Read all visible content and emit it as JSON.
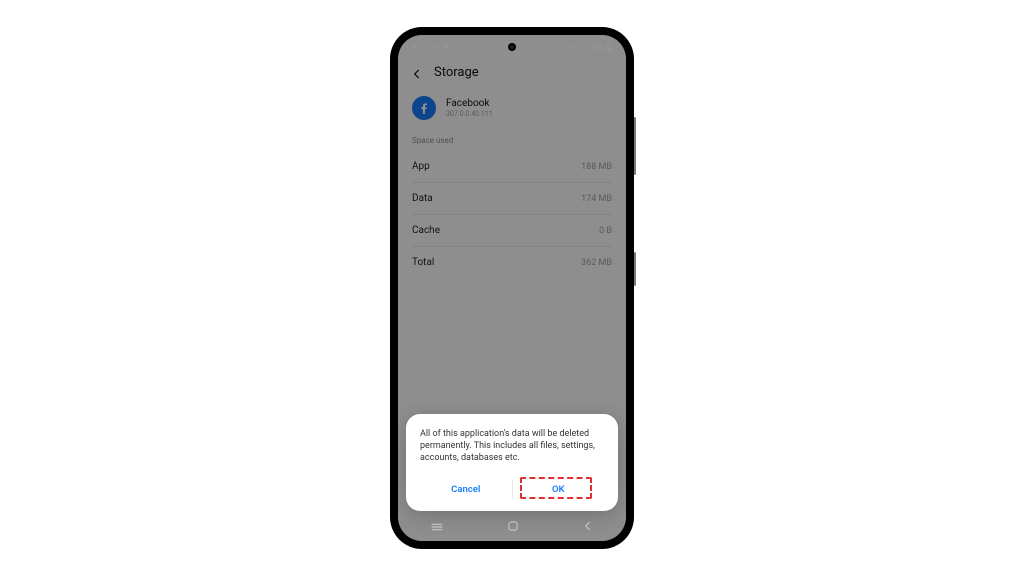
{
  "status": {
    "time": "9:17",
    "battery": "64%"
  },
  "header": {
    "title": "Storage"
  },
  "app": {
    "name": "Facebook",
    "version": "307.0.0.40.111"
  },
  "section_label": "Space used",
  "rows": {
    "app": {
      "label": "App",
      "value": "188 MB"
    },
    "data": {
      "label": "Data",
      "value": "174 MB"
    },
    "cache": {
      "label": "Cache",
      "value": "0 B"
    },
    "total": {
      "label": "Total",
      "value": "362 MB"
    }
  },
  "dialog": {
    "message": "All of this application's data will be deleted permanently. This includes all files, settings, accounts, databases etc.",
    "cancel": "Cancel",
    "ok": "OK"
  }
}
